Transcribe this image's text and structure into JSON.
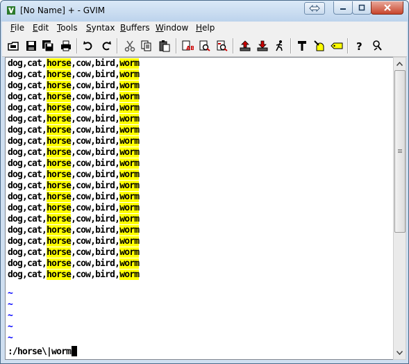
{
  "window": {
    "title": "[No Name] + - GVIM"
  },
  "menu": {
    "items": [
      {
        "accel": "F",
        "rest": "ile"
      },
      {
        "accel": "E",
        "rest": "dit"
      },
      {
        "accel": "T",
        "rest": "ools"
      },
      {
        "accel": "S",
        "rest": "yntax"
      },
      {
        "accel": "B",
        "rest": "uffers"
      },
      {
        "accel": "W",
        "rest": "indow"
      },
      {
        "accel": "H",
        "rest": "elp"
      }
    ]
  },
  "toolbar": {
    "icons": [
      "open-icon",
      "save-icon",
      "save-all-icon",
      "print-icon",
      "undo-icon",
      "redo-icon",
      "cut-icon",
      "copy-icon",
      "paste-icon",
      "replace-icon",
      "find-next-icon",
      "find-prev-icon",
      "load-session-icon",
      "save-session-icon",
      "run-script-icon",
      "make-icon",
      "shell-icon",
      "tags-icon",
      "help-icon",
      "find-help-icon"
    ]
  },
  "editor": {
    "lines": [
      {
        "pre": "dog,cat,",
        "m1": "horse",
        "mid": ",cow,bird,",
        "m2": "worm"
      },
      {
        "pre": "dog,cat,",
        "m1": "horse",
        "mid": ",cow,bird,",
        "m2": "worm"
      },
      {
        "pre": "dog,cat,",
        "m1": "horse",
        "mid": ",cow,bird,",
        "m2": "worm"
      },
      {
        "pre": "dog,cat,",
        "m1": "horse",
        "mid": ",cow,bird,",
        "m2": "worm"
      },
      {
        "pre": "dog,cat,",
        "m1": "horse",
        "mid": ",cow,bird,",
        "m2": "worm"
      },
      {
        "pre": "dog,cat,",
        "m1": "horse",
        "mid": ",cow,bird,",
        "m2": "worm"
      },
      {
        "pre": "dog,cat,",
        "m1": "horse",
        "mid": ",cow,bird,",
        "m2": "worm"
      },
      {
        "pre": "dog,cat,",
        "m1": "horse",
        "mid": ",cow,bird,",
        "m2": "worm"
      },
      {
        "pre": "dog,cat,",
        "m1": "horse",
        "mid": ",cow,bird,",
        "m2": "worm"
      },
      {
        "pre": "dog,cat,",
        "m1": "horse",
        "mid": ",cow,bird,",
        "m2": "worm"
      },
      {
        "pre": "dog,cat,",
        "m1": "horse",
        "mid": ",cow,bird,",
        "m2": "worm"
      },
      {
        "pre": "dog,cat,",
        "m1": "horse",
        "mid": ",cow,bird,",
        "m2": "worm"
      },
      {
        "pre": "dog,cat,",
        "m1": "horse",
        "mid": ",cow,bird,",
        "m2": "worm"
      },
      {
        "pre": "dog,cat,",
        "m1": "horse",
        "mid": ",cow,bird,",
        "m2": "worm"
      },
      {
        "pre": "dog,cat,",
        "m1": "horse",
        "mid": ",cow,bird,",
        "m2": "worm"
      },
      {
        "pre": "dog,cat,",
        "m1": "horse",
        "mid": ",cow,bird,",
        "m2": "worm"
      },
      {
        "pre": "dog,cat,",
        "m1": "horse",
        "mid": ",cow,bird,",
        "m2": "worm"
      },
      {
        "pre": "dog,cat,",
        "m1": "horse",
        "mid": ",cow,bird,",
        "m2": "worm"
      },
      {
        "pre": "dog,cat,",
        "m1": "horse",
        "mid": ",cow,bird,",
        "m2": "worm"
      },
      {
        "pre": "dog,cat,",
        "m1": "horse",
        "mid": ",cow,bird,",
        "m2": "worm"
      }
    ],
    "tildes": [
      "~",
      "~",
      "~",
      "~",
      "~"
    ],
    "command": ":/horse\\|worm",
    "highlight_color": "#ffff00",
    "tilde_color": "#0000ff"
  }
}
